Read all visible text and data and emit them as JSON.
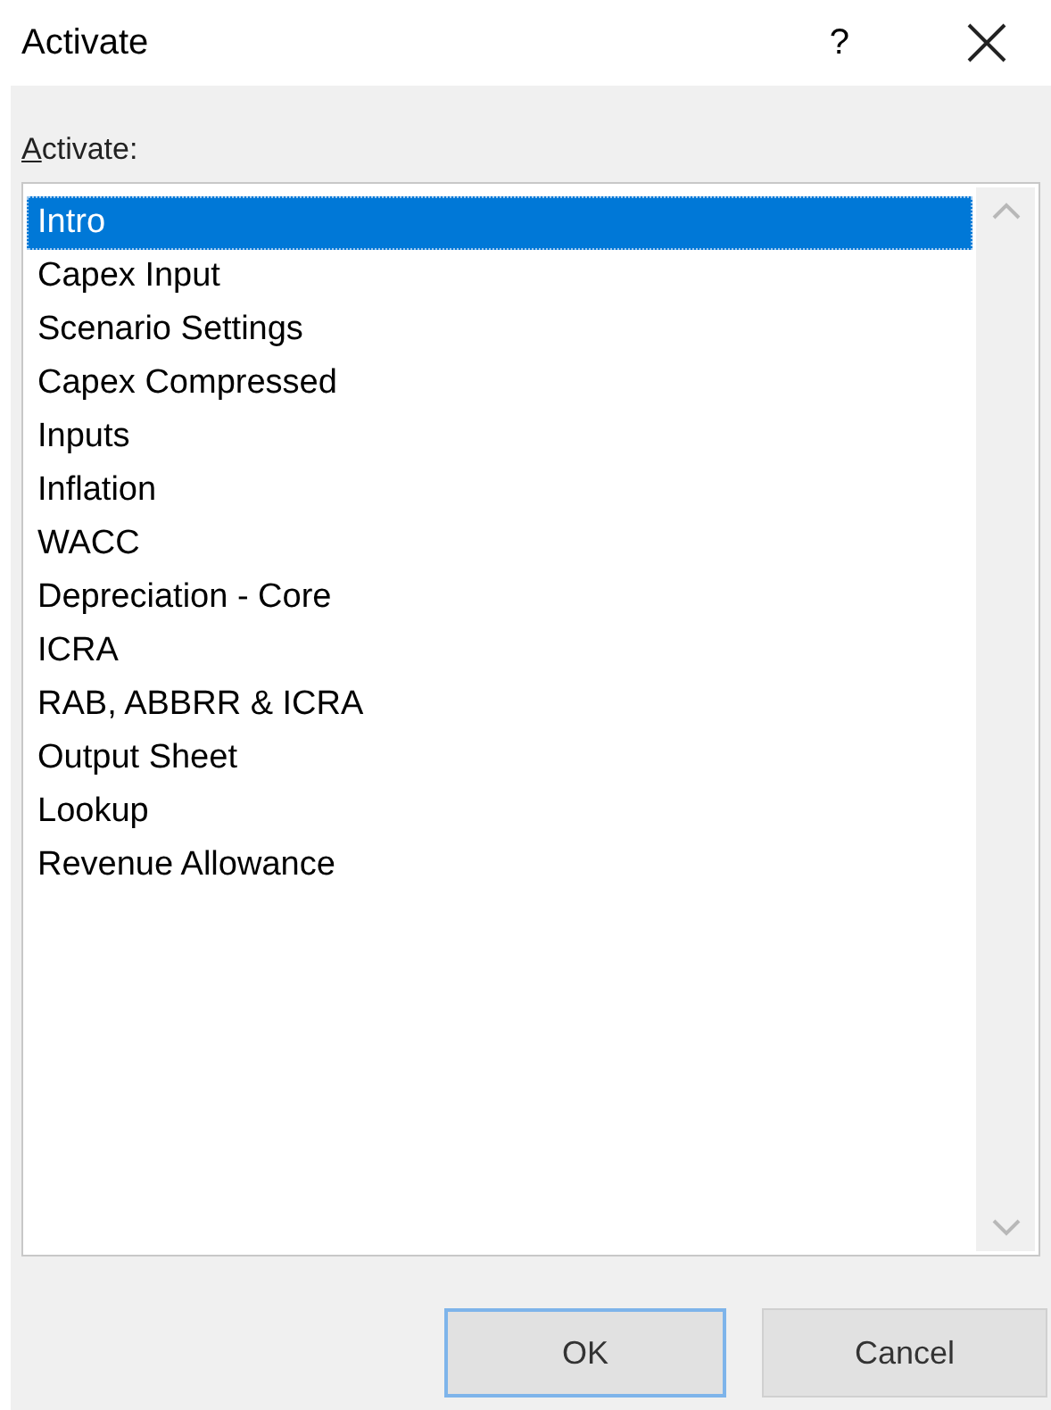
{
  "window": {
    "title": "Activate",
    "help": "?"
  },
  "list": {
    "label": "Activate:",
    "items": [
      {
        "label": "Intro",
        "selected": true
      },
      {
        "label": "Capex Input",
        "selected": false
      },
      {
        "label": "Scenario Settings",
        "selected": false
      },
      {
        "label": "Capex Compressed",
        "selected": false
      },
      {
        "label": "Inputs",
        "selected": false
      },
      {
        "label": "Inflation",
        "selected": false
      },
      {
        "label": "WACC",
        "selected": false
      },
      {
        "label": "Depreciation - Core",
        "selected": false
      },
      {
        "label": "ICRA",
        "selected": false
      },
      {
        "label": "RAB, ABBRR & ICRA",
        "selected": false
      },
      {
        "label": "Output Sheet",
        "selected": false
      },
      {
        "label": "Lookup",
        "selected": false
      },
      {
        "label": "Revenue Allowance",
        "selected": false
      }
    ]
  },
  "buttons": [
    {
      "label": "OK",
      "default": true
    },
    {
      "label": "Cancel",
      "default": false
    }
  ]
}
